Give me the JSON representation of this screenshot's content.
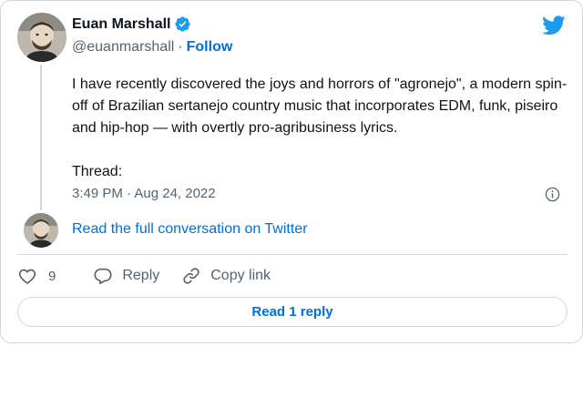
{
  "author": {
    "name": "Euan Marshall",
    "handle": "@euanmarshall",
    "separator": "·",
    "follow_label": "Follow"
  },
  "tweet": {
    "text_paragraph_1": "I have recently discovered the joys and horrors of \"agronejo\", a modern spin-off of Brazilian sertanejo country music that incorporates EDM, funk, piseiro and hip-hop — with overtly pro-agribusiness lyrics.",
    "text_paragraph_2": "Thread:",
    "timestamp": "3:49 PM · Aug 24, 2022"
  },
  "conversation_link": "Read the full conversation on Twitter",
  "actions": {
    "like_count": "9",
    "reply_label": "Reply",
    "copy_link_label": "Copy link"
  },
  "read_replies_label": "Read 1 reply",
  "colors": {
    "brand_blue": "#1d9bf0",
    "link_blue": "#006fd6",
    "text_primary": "#0f1419",
    "text_secondary": "#536471",
    "border": "#cfd9de"
  },
  "icons": {
    "brand": "twitter-bird-icon",
    "verified": "verified-badge-icon",
    "info": "info-icon",
    "like": "heart-icon",
    "reply": "speech-bubble-icon",
    "copy": "link-icon"
  }
}
